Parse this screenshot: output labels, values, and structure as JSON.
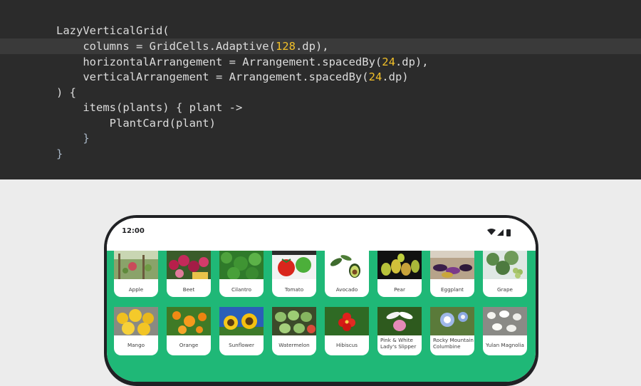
{
  "code": {
    "l1": "LazyVerticalGrid(",
    "l2_a": "    columns = GridCells.Adaptive(",
    "l2_n": "128",
    "l2_b": ".dp),",
    "l3_a": "    horizontalArrangement = Arrangement.spacedBy(",
    "l3_n": "24",
    "l3_b": ".dp),",
    "l4_a": "    verticalArrangement = Arrangement.spacedBy(",
    "l4_n": "24",
    "l4_b": ".dp)",
    "l5": ") {",
    "l6": "    items(plants) { plant ->",
    "l7": "        PlantCard(plant)",
    "l8": "    }",
    "l9": "}"
  },
  "phone": {
    "time": "12:00",
    "status_icons": [
      "wifi-icon",
      "cellular-icon",
      "battery-icon"
    ]
  },
  "colors": {
    "grid_background": "#1fb877",
    "number_literal": "#f2c029"
  },
  "plants": [
    {
      "name": "Apple"
    },
    {
      "name": "Beet"
    },
    {
      "name": "Cilantro"
    },
    {
      "name": "Tomato"
    },
    {
      "name": "Avocado"
    },
    {
      "name": "Pear"
    },
    {
      "name": "Eggplant"
    },
    {
      "name": "Grape"
    },
    {
      "name": "Mango"
    },
    {
      "name": "Orange"
    },
    {
      "name": "Sunflower"
    },
    {
      "name": "Watermelon"
    },
    {
      "name": "Hibiscus"
    },
    {
      "name_l1": "Pink & White",
      "name_l2": "Lady's Slipper"
    },
    {
      "name_l1": "Rocky Mountain",
      "name_l2": "Columbine"
    },
    {
      "name": "Yulan Magnolia"
    }
  ]
}
